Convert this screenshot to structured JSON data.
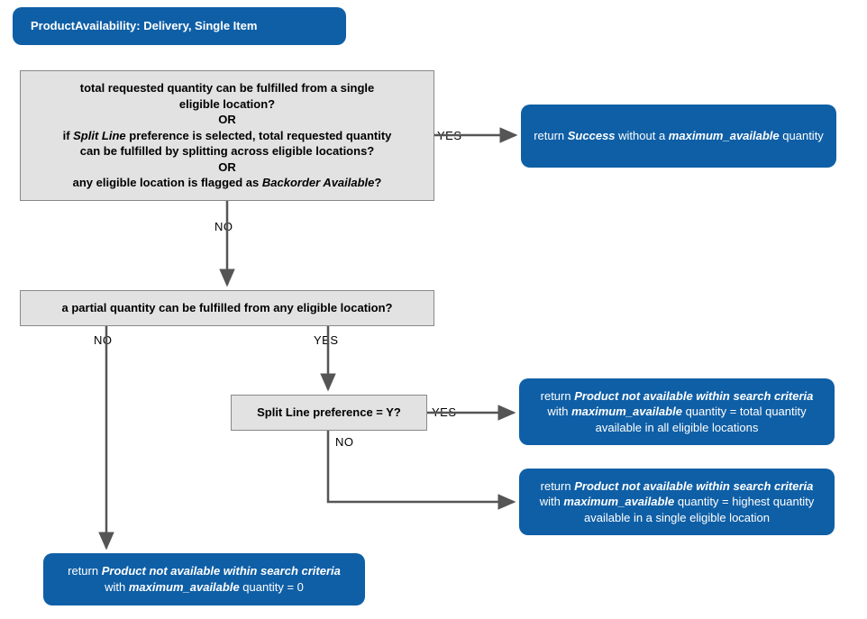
{
  "title": "ProductAvailability: Delivery, Single Item",
  "decision1": {
    "line1": "total requested quantity can be fulfilled from a single",
    "line2": "eligible location?",
    "or1": "OR",
    "line3a": "if ",
    "line3i": "Split Line",
    "line3b": " preference is selected, total requested quantity",
    "line4": "can be fulfilled by splitting across eligible locations?",
    "or2": "OR",
    "line5a": "any eligible location is flagged as ",
    "line5i": "Backorder Available",
    "line5b": "?"
  },
  "decision2": "a partial quantity can be fulfilled from any eligible location?",
  "decision3": "Split Line preference = Y?",
  "result1": {
    "a": "return ",
    "i1": "Success",
    "b": " without a ",
    "i2": "maximum_available",
    "c": " quantity"
  },
  "result2": {
    "a": "return ",
    "i1": "Product not available within search criteria",
    "b": " with ",
    "i2": "maximum_available",
    "c": " quantity = total quantity available in all eligible locations"
  },
  "result3": {
    "a": "return ",
    "i1": "Product not available within search criteria",
    "b": " with ",
    "i2": "maximum_available",
    "c": " quantity = highest quantity available in a single  eligible location"
  },
  "result4": {
    "a": "return ",
    "i1": "Product not available within search criteria",
    "b": " with ",
    "i2": "maximum_available",
    "c": " quantity = 0"
  },
  "labels": {
    "yes": "YES",
    "no": "NO"
  }
}
